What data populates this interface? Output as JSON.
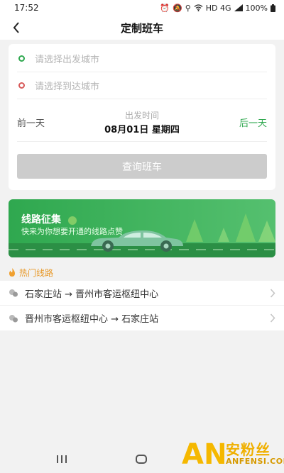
{
  "status_bar": {
    "time": "17:52",
    "network": "HD 4G",
    "battery": "100%",
    "icons": [
      "alarm-icon",
      "mute-icon",
      "location-icon",
      "wifi-icon",
      "signal-icon",
      "battery-icon"
    ]
  },
  "nav": {
    "title": "定制班车",
    "back_icon": "chevron-left-icon"
  },
  "form": {
    "from_placeholder": "请选择出发城市",
    "to_placeholder": "请选择到达城市",
    "prev_day": "前一天",
    "next_day": "后一天",
    "depart_label": "出发时间",
    "depart_date": "08月01日 星期四",
    "query_button": "查询班车"
  },
  "banner": {
    "title": "线路征集",
    "subtitle": "快来为你想要开通的线路点赞"
  },
  "hot_routes": {
    "title": "热门线路",
    "items": [
      {
        "label": "石家庄站 → 晋州市客运枢纽中心"
      },
      {
        "label": "晋州市客运枢纽中心 → 石家庄站"
      }
    ]
  },
  "watermark": {
    "logo_text": "AN",
    "cn": "安粉丝",
    "en": "ANFENSI.COM"
  },
  "colors": {
    "accent_green": "#2fa84f",
    "hot_orange": "#e89a2b",
    "button_disabled": "#cccccc"
  }
}
